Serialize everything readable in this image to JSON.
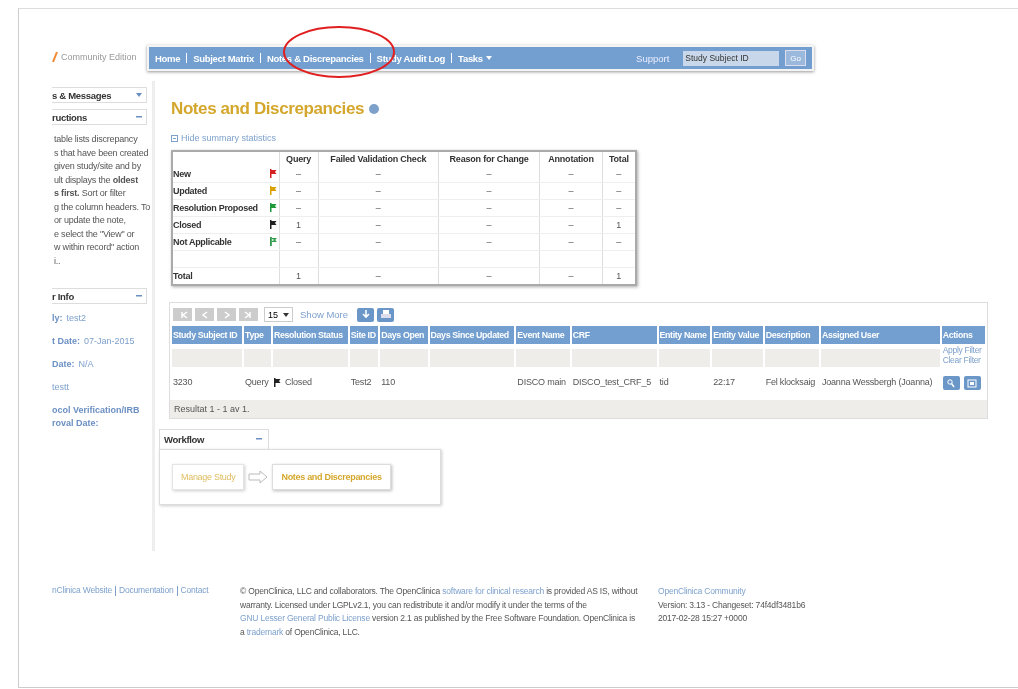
{
  "brand": {
    "edition": "Community Edition"
  },
  "nav": {
    "items": [
      {
        "label": "Home",
        "dropdown": false
      },
      {
        "label": "Subject Matrix",
        "dropdown": false
      },
      {
        "label": "Notes & Discrepancies",
        "dropdown": false
      },
      {
        "label": "Study Audit Log",
        "dropdown": false
      },
      {
        "label": "Tasks",
        "dropdown": true
      }
    ],
    "support": "Support",
    "search": {
      "placeholder": "Study Subject ID"
    },
    "go": "Go"
  },
  "sidebar": {
    "panels": [
      {
        "title": "s & Messages",
        "expanded": false
      },
      {
        "title": "ructions",
        "expanded": true,
        "lines": [
          "table lists discrepancy",
          "s that have been created",
          "given study/site and by",
          "ult displays the **oldest**",
          "**s first.** Sort or filter",
          "g the column headers. To",
          "or update the note,",
          "e select the \"View\" or",
          "w within record\" action",
          "i.."
        ]
      },
      {
        "title": "r Info",
        "expanded": true,
        "fields": [
          {
            "label": "ly:",
            "value": "test2"
          },
          {
            "label": "t Date:",
            "value": "07-Jan-2015"
          },
          {
            "label": "Date:",
            "value": "N/A"
          },
          {
            "value": "testt"
          },
          {
            "label": "ocol Verification/IRB roval Date:"
          }
        ]
      }
    ]
  },
  "page": {
    "title": "Notes and Discrepancies",
    "hide_stats": "Hide summary statistics"
  },
  "summary": {
    "columns": [
      "Query",
      "Failed Validation Check",
      "Reason for Change",
      "Annotation",
      "Total"
    ],
    "rows": [
      {
        "label": "New",
        "color": "#d42020",
        "kind": "solid",
        "cells": [
          "–",
          "–",
          "–",
          "–",
          "–"
        ]
      },
      {
        "label": "Updated",
        "color": "#d9a000",
        "kind": "solid",
        "cells": [
          "–",
          "–",
          "–",
          "–",
          "–"
        ]
      },
      {
        "label": "Resolution Proposed",
        "color": "#1f9a3a",
        "kind": "solid",
        "cells": [
          "–",
          "–",
          "–",
          "–",
          "–"
        ]
      },
      {
        "label": "Closed",
        "color": "#222222",
        "kind": "solid",
        "cells": [
          "1",
          "–",
          "–",
          "–",
          "1"
        ]
      },
      {
        "label": "Not Applicable",
        "color": "#2e9a4a",
        "kind": "outline",
        "cells": [
          "–",
          "–",
          "–",
          "–",
          "–"
        ]
      },
      {
        "label": "Total",
        "kind": "total",
        "cells": [
          "1",
          "–",
          "–",
          "–",
          "1"
        ]
      }
    ]
  },
  "listing": {
    "page_size": "15",
    "show_more": "Show More",
    "columns": [
      "Study Subject ID",
      "Type",
      "Resolution Status",
      "Site ID",
      "Days Open",
      "Days Since Updated",
      "Event Name",
      "CRF",
      "Entity Name",
      "Entity Value",
      "Description",
      "Assigned User",
      "Actions"
    ],
    "apply_filter": "Apply Filter",
    "clear_filter": "Clear Filter",
    "rows": [
      {
        "cells": [
          "3230",
          "Query",
          "Closed",
          "Test2",
          "110",
          "",
          "DISCO main",
          "DISCO_test_CRF_5",
          "tid",
          "22:17",
          "Fel klocksaig",
          "Joanna Wessbergh (Joanna)"
        ],
        "color": "#222222"
      }
    ],
    "result": "Resultat 1 - 1 av 1."
  },
  "workflow": {
    "title": "Workflow",
    "steps": [
      {
        "label": "Manage Study",
        "selected": false
      },
      {
        "label": "Notes and Discrepancies",
        "selected": true
      }
    ]
  },
  "footer": {
    "links": [
      "nClinica Website",
      "Documentation",
      "Contact"
    ],
    "copyright": "© OpenClinica, LLC and collaborators. The OpenClinica ",
    "link1": "software for clinical research",
    "mid1": " is provided AS IS, without warranty. Licensed under LGPLv2.1, you can redistribute it and/or modify it under the terms of the ",
    "link2": "GNU Lesser General Public License",
    "mid2": " version 2.1 as published by the Free Software Foundation. OpenClinica is a ",
    "link3": "trademark",
    "end": " of OpenClinica, LLC.",
    "community": "OpenClinica Community",
    "version": "Version: 3.13 - Changeset: 74f4df3481b6",
    "date": "2017-02-28 15:27 +0000"
  }
}
